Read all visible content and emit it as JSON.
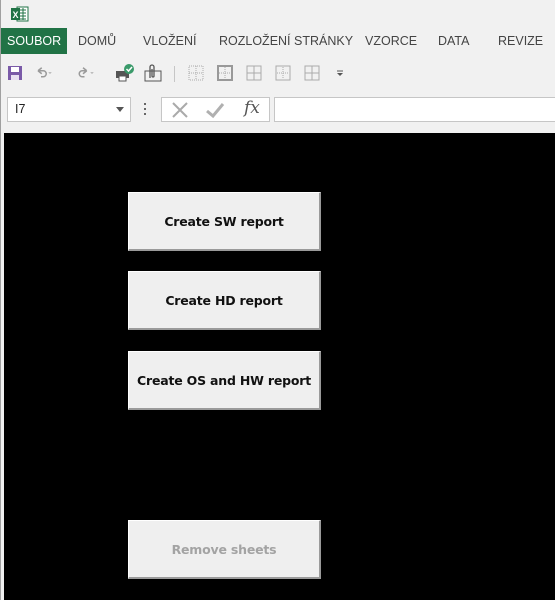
{
  "app": {
    "icon": "excel-icon"
  },
  "ribbon": {
    "tabs": [
      {
        "label": "SOUBOR",
        "active": true
      },
      {
        "label": "DOMŮ"
      },
      {
        "label": "VLOŽENÍ"
      },
      {
        "label": "ROZLOŽENÍ STRÁNKY"
      },
      {
        "label": "VZORCE"
      },
      {
        "label": "DATA"
      },
      {
        "label": "REVIZE"
      }
    ],
    "accent_color": "#217346"
  },
  "quick_access": {
    "items": [
      "save-icon",
      "undo-icon",
      "redo-icon",
      "print-check-icon",
      "attach-icon",
      "borders-none-icon",
      "borders-outside-icon",
      "borders-all-icon",
      "borders-inside-icon",
      "borders-grid-icon",
      "customize-dropdown-icon"
    ]
  },
  "formula_bar": {
    "name_box": "I7",
    "formula_value": "",
    "fx_label": "fx"
  },
  "sheet": {
    "buttons": [
      {
        "label": "Create SW report",
        "enabled": true
      },
      {
        "label": "Create HD report",
        "enabled": true
      },
      {
        "label": "Create OS and HW report",
        "enabled": true
      },
      {
        "label": "Remove sheets",
        "enabled": false
      }
    ]
  }
}
